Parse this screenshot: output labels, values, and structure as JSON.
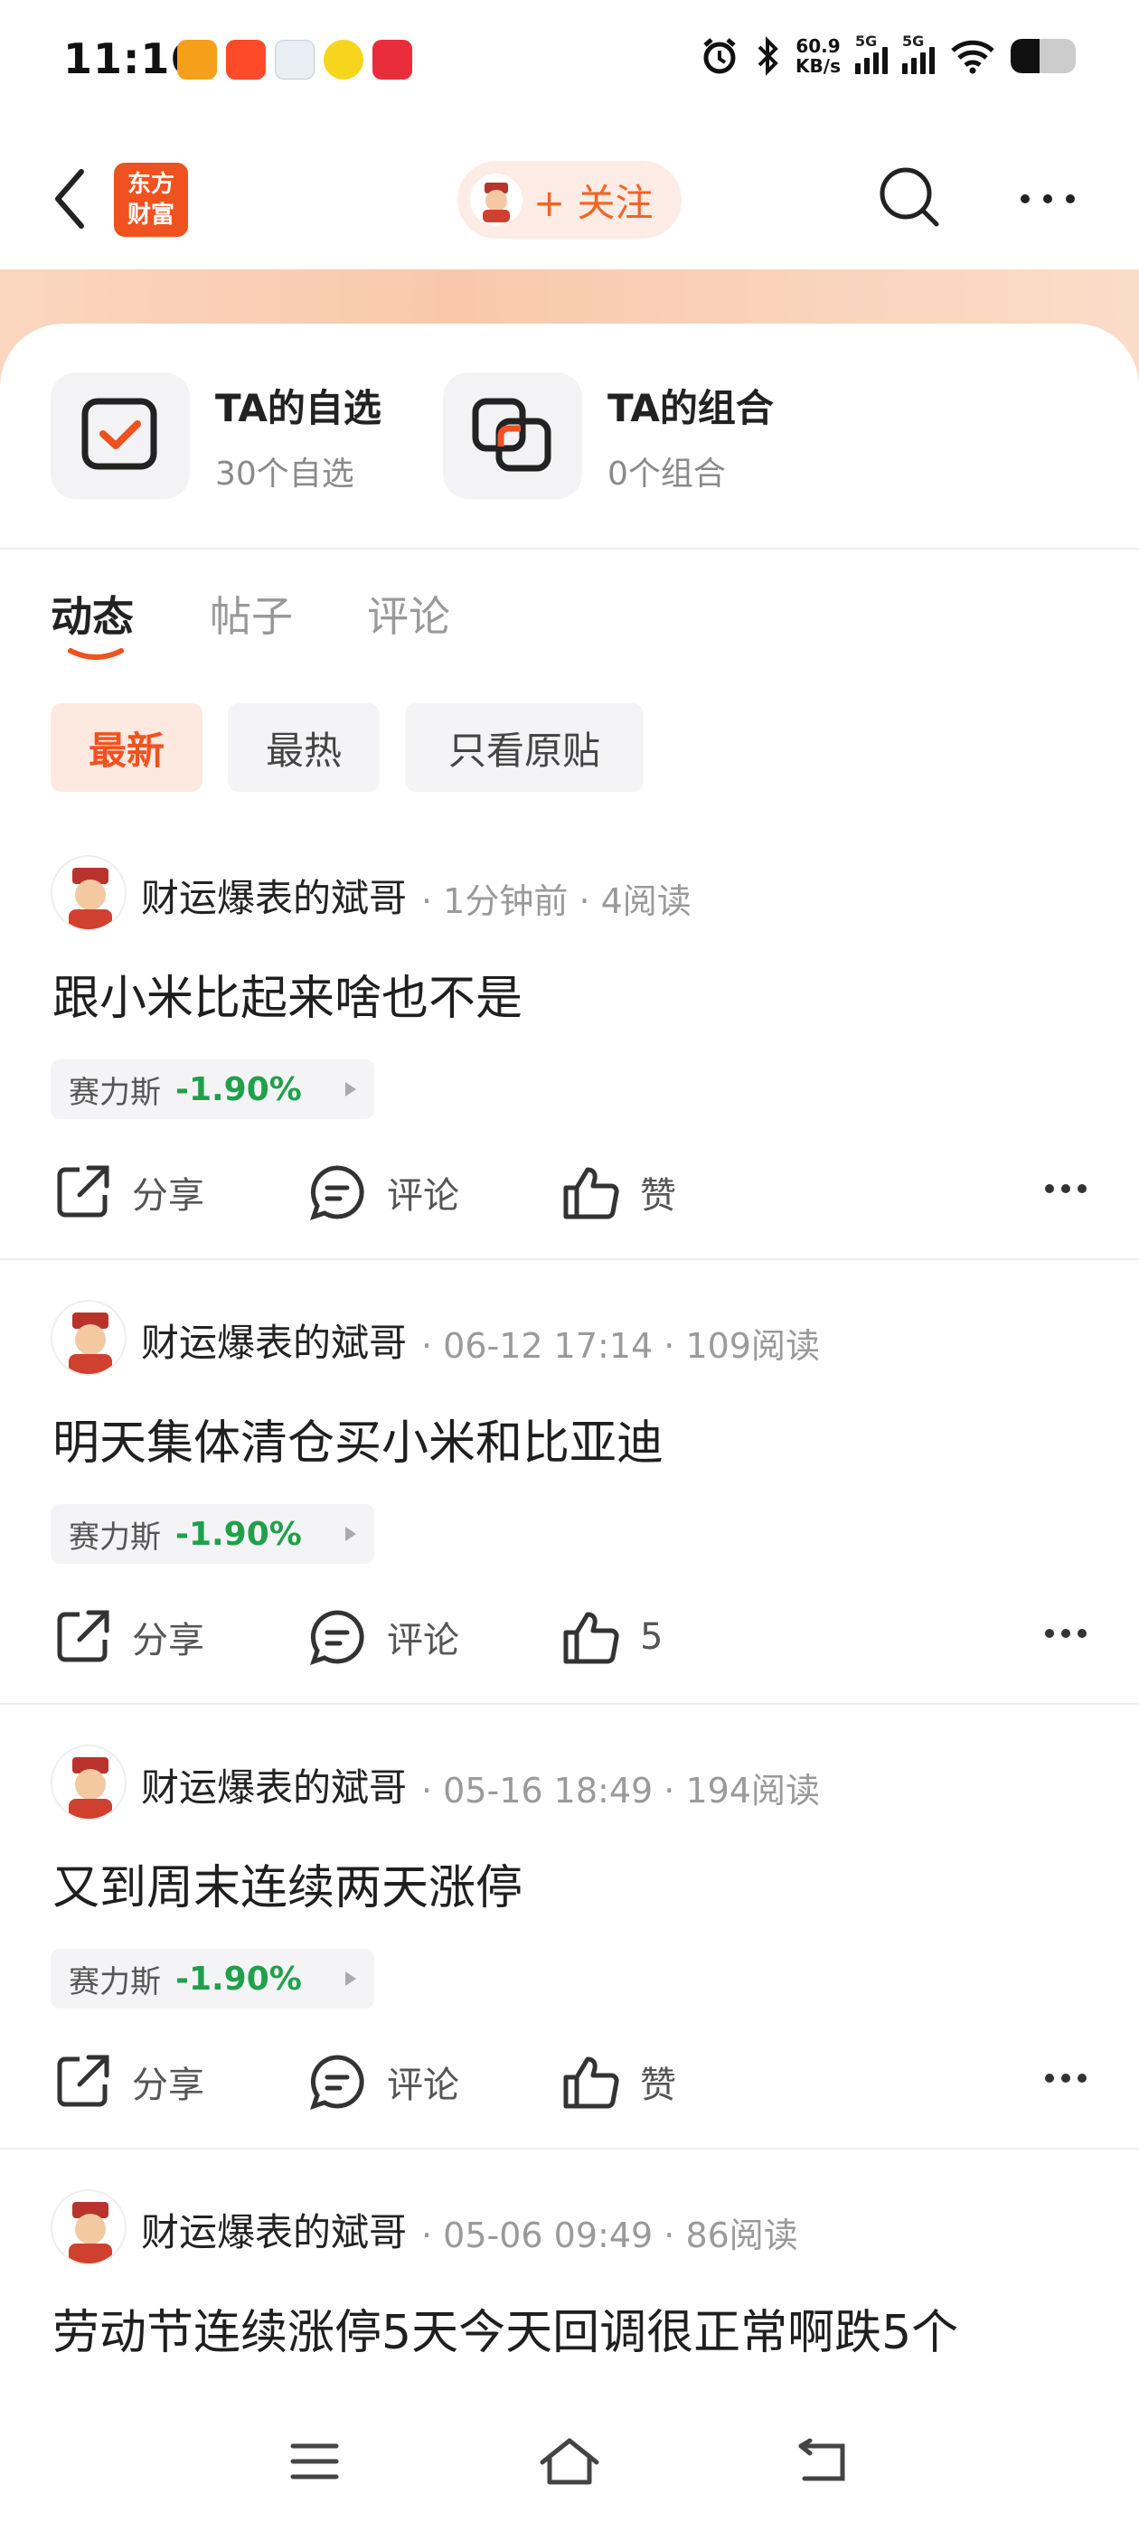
{
  "status_bar": {
    "time": "11:16",
    "net_speed_value": "60.9",
    "net_speed_unit": "KB/s",
    "sim1_label": "5G",
    "sim2_label": "5G",
    "battery_level": 0.45,
    "notification_icons": [
      "tianhong-app-icon",
      "taobao-app-icon",
      "maps-app-icon",
      "fruit-app-icon",
      "store-app-icon"
    ]
  },
  "nav": {
    "logo_line1": "东方",
    "logo_line2": "财富",
    "follow_label": "+ 关注"
  },
  "tiles": [
    {
      "title": "TA的自选",
      "subtitle": "30个自选"
    },
    {
      "title": "TA的组合",
      "subtitle": "0个组合"
    }
  ],
  "tabs": [
    "动态",
    "帖子",
    "评论"
  ],
  "filters": [
    "最新",
    "最热",
    "只看原贴"
  ],
  "posts": [
    {
      "author": "财运爆表的斌哥",
      "time": "1分钟前",
      "reads": "4阅读",
      "content": "跟小米比起来啥也不是",
      "stock_name": "赛力斯",
      "stock_change": "-1.90%",
      "share_label": "分享",
      "comment_label": "评论",
      "like_label": "赞"
    },
    {
      "author": "财运爆表的斌哥",
      "time": "06-12 17:14",
      "reads": "109阅读",
      "content": "明天集体清仓买小米和比亚迪",
      "stock_name": "赛力斯",
      "stock_change": "-1.90%",
      "share_label": "分享",
      "comment_label": "评论",
      "like_label": "5"
    },
    {
      "author": "财运爆表的斌哥",
      "time": "05-16 18:49",
      "reads": "194阅读",
      "content": "又到周末连续两天涨停",
      "stock_name": "赛力斯",
      "stock_change": "-1.90%",
      "share_label": "分享",
      "comment_label": "评论",
      "like_label": "赞"
    },
    {
      "author": "财运爆表的斌哥",
      "time": "05-06 09:49",
      "reads": "86阅读",
      "content": "劳动节连续涨停5天今天回调很正常啊跌5个"
    }
  ],
  "colors": {
    "brand_orange": "#f0521f",
    "follow_text": "#f06524",
    "stock_down_green": "#20a04a"
  }
}
